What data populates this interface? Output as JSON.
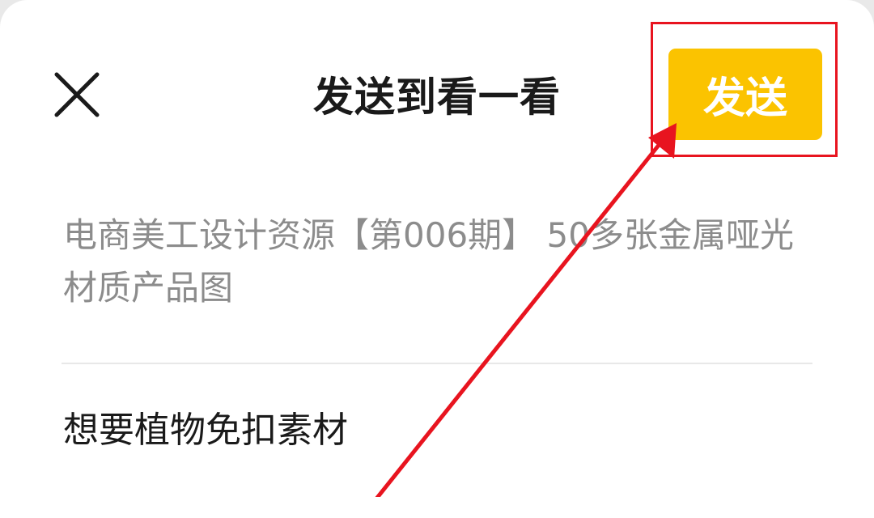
{
  "header": {
    "title": "发送到看一看",
    "send_label": "发送",
    "close_icon": "close-icon"
  },
  "post": {
    "caption": "电商美工设计资源【第006期】 50多张金属哑光材质产品图"
  },
  "comment": {
    "value": "想要植物免扣素材"
  },
  "colors": {
    "send_button_bg": "#fbc300",
    "annotation_red": "#e8141f"
  }
}
